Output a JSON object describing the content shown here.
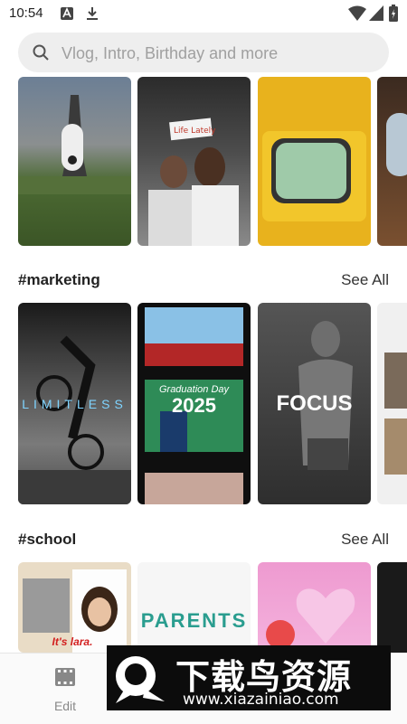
{
  "status_bar": {
    "time": "10:54"
  },
  "search": {
    "placeholder": "Vlog, Intro, Birthday and more"
  },
  "sections": [
    {
      "title": "#marketing",
      "see_all": "See All"
    },
    {
      "title": "#school",
      "see_all": "See All"
    }
  ],
  "thumb_text": {
    "limitless": "LIMITLESS",
    "graduation": "Graduation Day",
    "year": "2025",
    "focus": "FOCUS",
    "parents": "PARENTS",
    "its_lara": "It's lara."
  },
  "nav": {
    "edit_label": "Edit"
  },
  "watermark": {
    "title": "下载鸟资源",
    "url": "www.xiazainiao.com"
  }
}
